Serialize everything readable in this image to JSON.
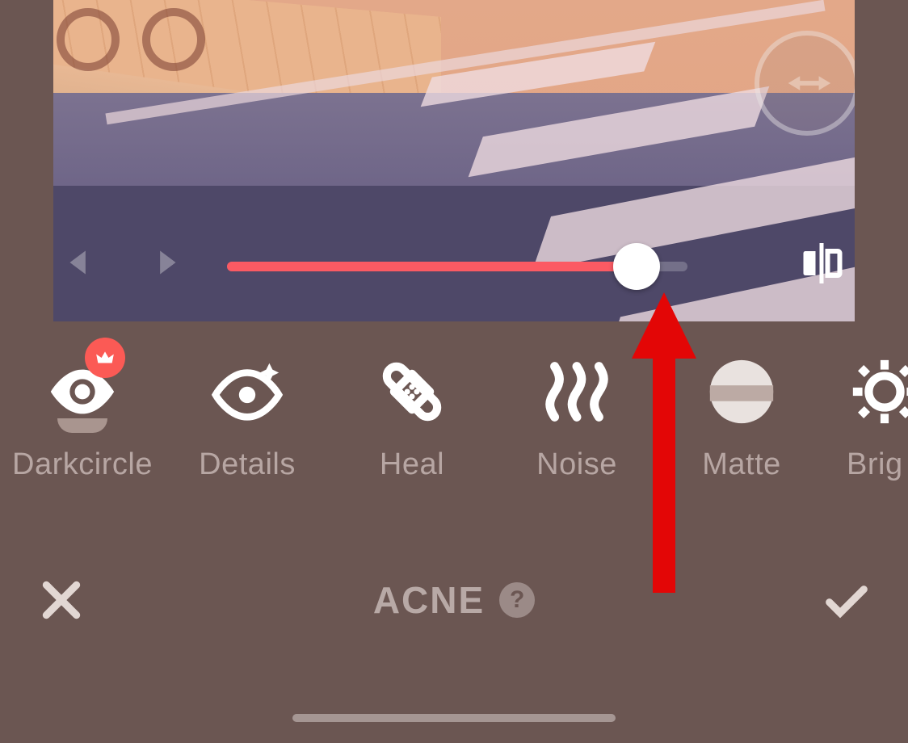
{
  "slider": {
    "percent": 89
  },
  "tools": {
    "items": [
      {
        "id": "darkcircle",
        "label": "Darkcircle",
        "premium": true
      },
      {
        "id": "details",
        "label": "Details"
      },
      {
        "id": "heal",
        "label": "Heal"
      },
      {
        "id": "noise",
        "label": "Noise"
      },
      {
        "id": "matte",
        "label": "Matte"
      },
      {
        "id": "brightness",
        "label": "Brig"
      }
    ]
  },
  "title": "ACNE",
  "help_glyph": "?"
}
